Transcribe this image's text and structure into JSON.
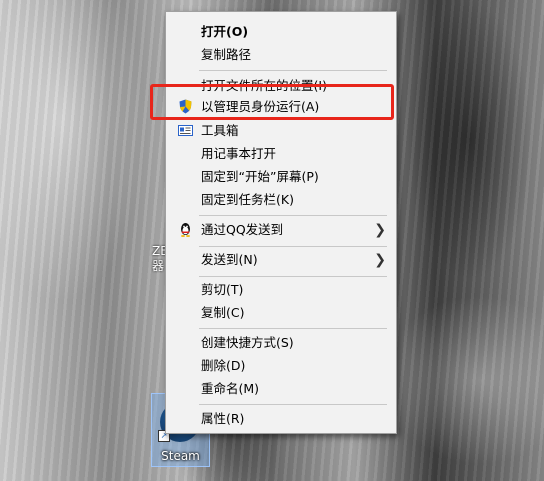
{
  "desktop": {
    "side_label_line1": "ZE",
    "side_label_line2": "器",
    "steam_label": "Steam"
  },
  "context_menu": {
    "open": "打开(O)",
    "copy_path": "复制路径",
    "open_file_location": "打开文件所在的位置(I)",
    "run_as_admin": "以管理员身份运行(A)",
    "toolbox": "工具箱",
    "open_with_notepad": "用记事本打开",
    "pin_to_start": "固定到“开始”屏幕(P)",
    "pin_to_taskbar": "固定到任务栏(K)",
    "send_via_qq": "通过QQ发送到",
    "send_to": "发送到(N)",
    "cut": "剪切(T)",
    "copy": "复制(C)",
    "create_shortcut": "创建快捷方式(S)",
    "delete": "删除(D)",
    "rename": "重命名(M)",
    "properties": "属性(R)"
  },
  "colors": {
    "highlight_border": "#e8261b",
    "menu_bg": "#f2f2f2"
  }
}
